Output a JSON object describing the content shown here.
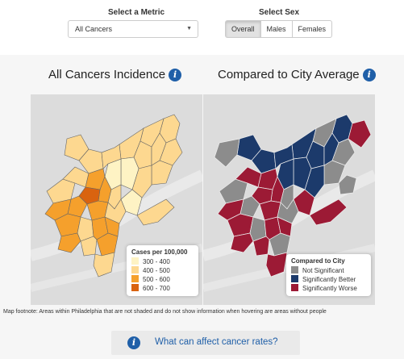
{
  "metric": {
    "label": "Select a Metric",
    "value": "All Cancers"
  },
  "sex": {
    "label": "Select Sex",
    "options": [
      "Overall",
      "Males",
      "Females"
    ],
    "selected": "Overall"
  },
  "left_map": {
    "title": "All Cancers Incidence",
    "legend_title": "Cases per 100,000",
    "legend": [
      {
        "label": "300 - 400",
        "color": "#fef3c4"
      },
      {
        "label": "400 - 500",
        "color": "#fdd890"
      },
      {
        "label": "500 - 600",
        "color": "#f5a02c"
      },
      {
        "label": "600 - 700",
        "color": "#d9630f"
      }
    ]
  },
  "right_map": {
    "title": "Compared to City Average",
    "legend_title": "Compared to City",
    "legend": [
      {
        "label": "Not Significant",
        "color": "#8c8c8c"
      },
      {
        "label": "Significantly Better",
        "color": "#1c3a6b"
      },
      {
        "label": "Significantly Worse",
        "color": "#9c1a35"
      }
    ]
  },
  "footnote": "Map footnote: Areas within Philadelphia that are not shaded and do not show information when hovering are areas without people",
  "cta": "What can affect cancer rates?"
}
